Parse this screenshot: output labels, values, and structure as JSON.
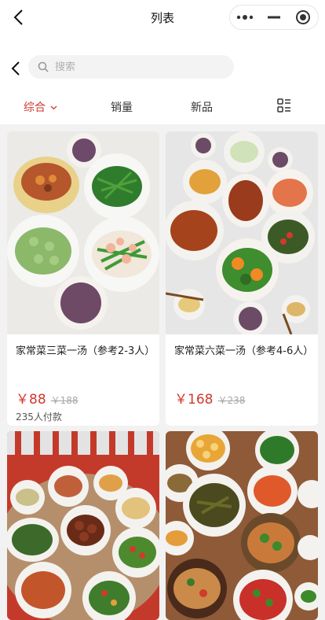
{
  "navbar": {
    "title": "列表",
    "back_icon": "chevron-left-icon",
    "capsule_icons": [
      "more-dots-icon",
      "minimize-icon",
      "close-target-icon"
    ]
  },
  "search": {
    "placeholder": "搜索",
    "value": "",
    "icon": "search-icon"
  },
  "tabs": [
    {
      "label": "综合",
      "active": true,
      "icon": "chevron-down-icon"
    },
    {
      "label": "销量",
      "active": false
    },
    {
      "label": "新品",
      "active": false
    }
  ],
  "layout_toggle_icon": "list-layout-icon",
  "colors": {
    "accent": "#d0392e",
    "page_bg": "#f2f2f2"
  },
  "products": [
    {
      "title": "家常菜三菜一汤（参考2-3人）",
      "price": "￥88",
      "original_price": "￥188",
      "sold": "235人付款"
    },
    {
      "title": "家常菜六菜一汤（参考4-6人）",
      "price": "￥168",
      "original_price": "￥238",
      "sold": ""
    },
    {
      "title": "",
      "price": "",
      "original_price": "",
      "sold": ""
    },
    {
      "title": "",
      "price": "",
      "original_price": "",
      "sold": ""
    }
  ]
}
